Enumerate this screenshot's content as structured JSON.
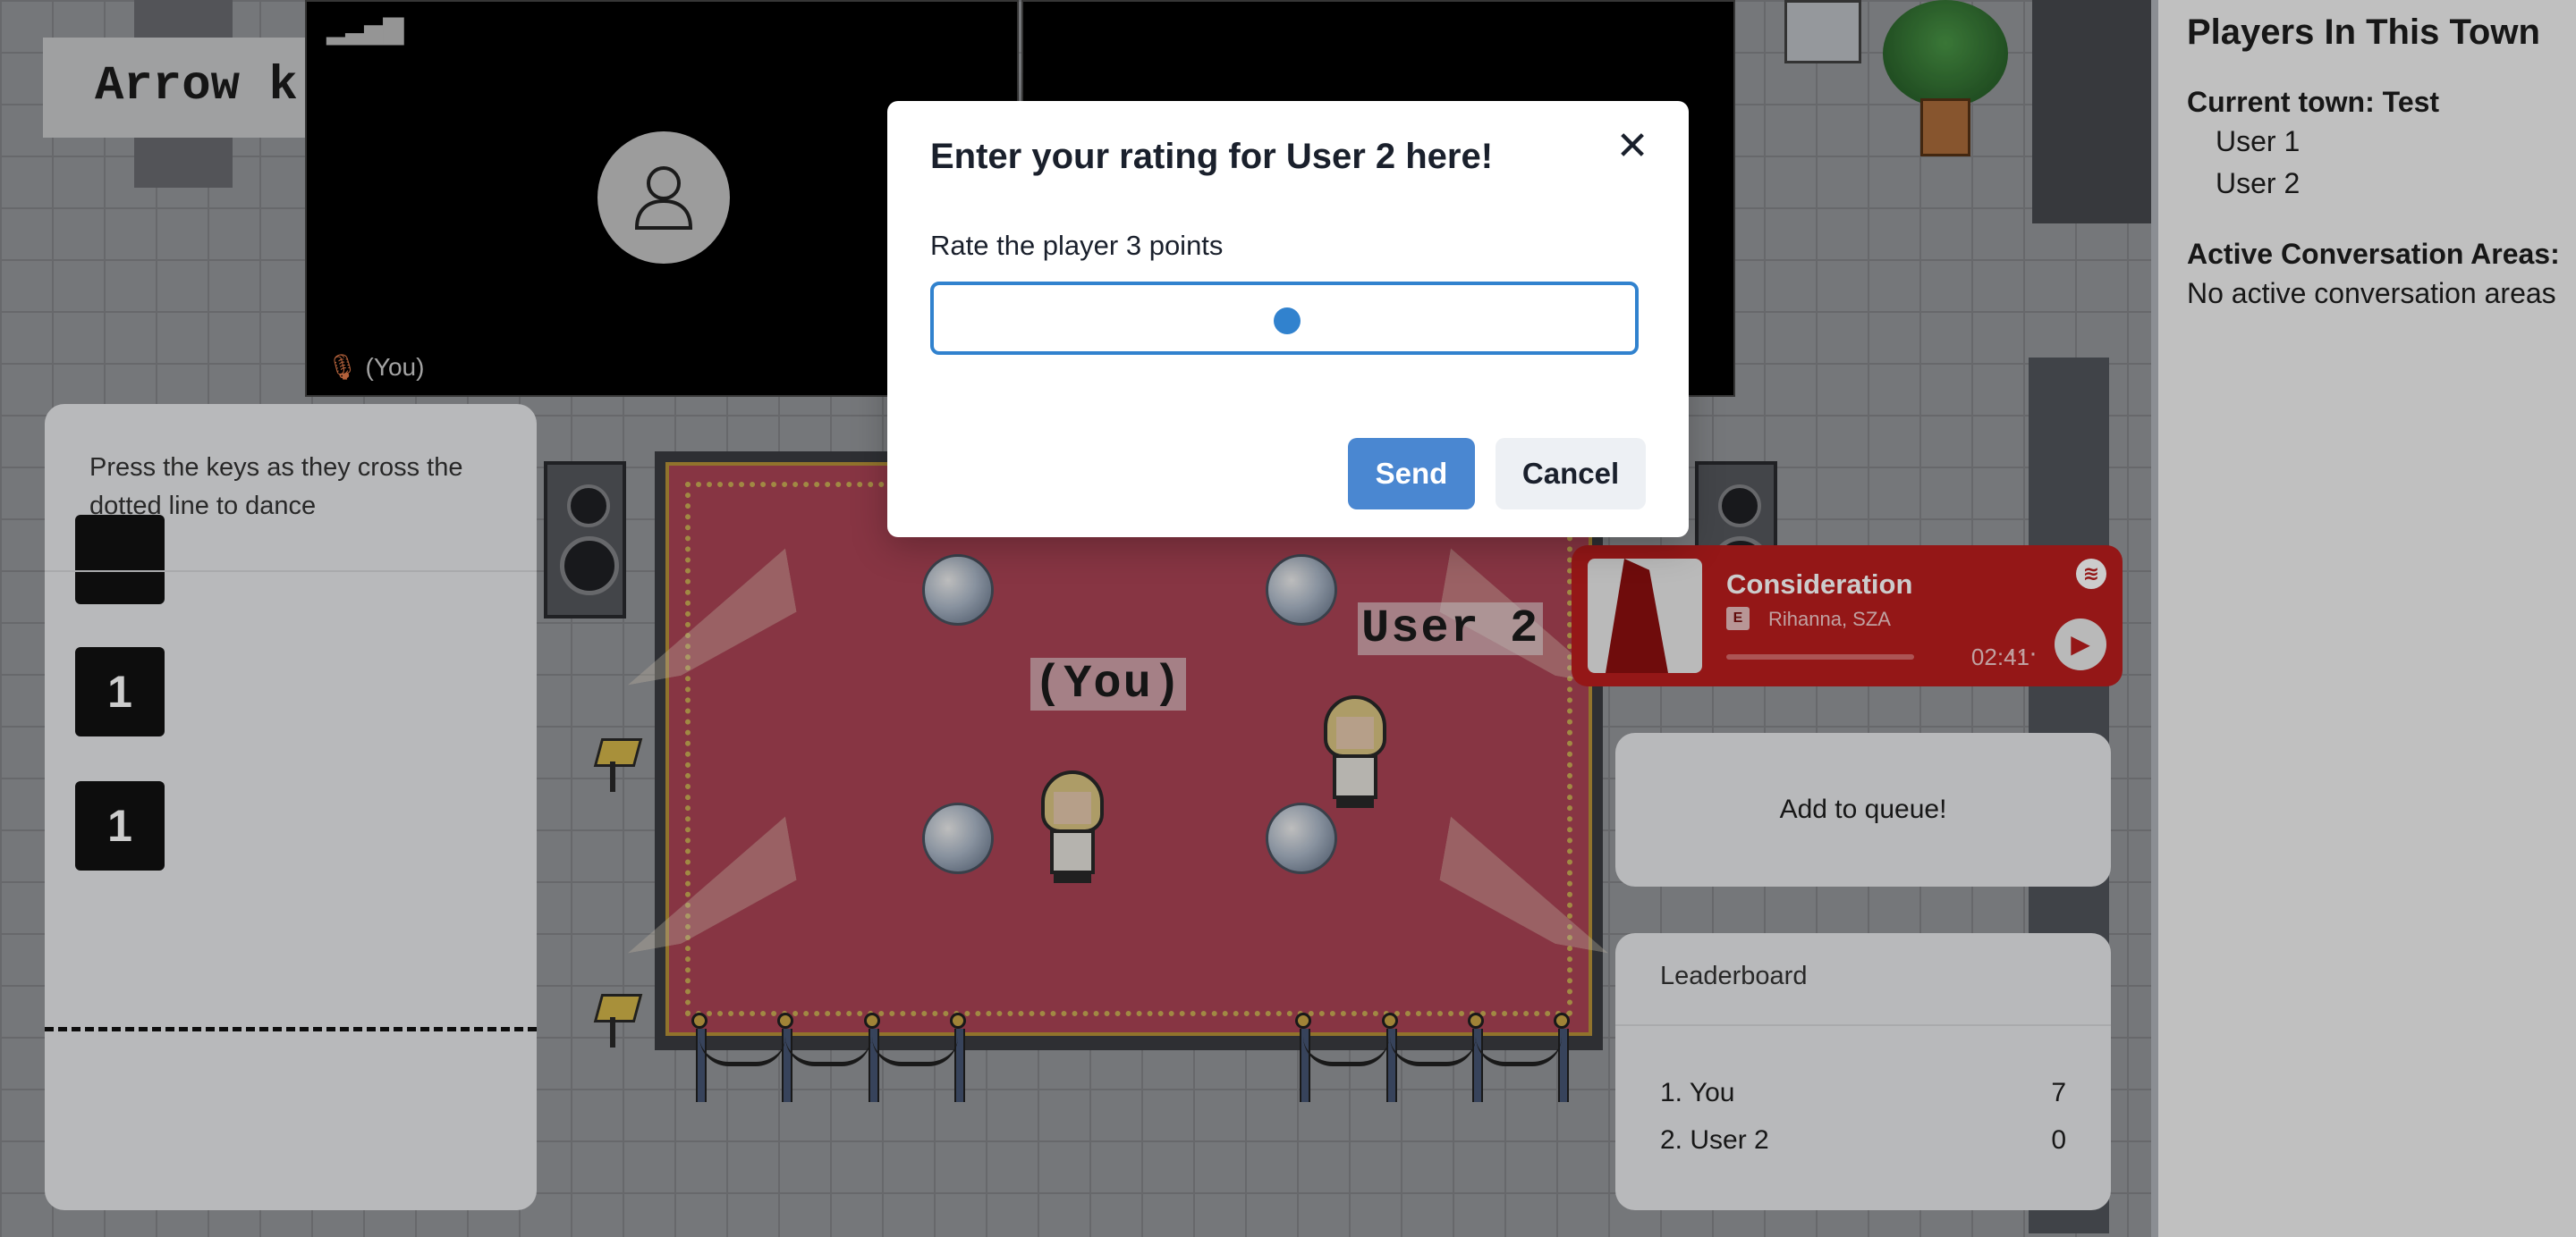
{
  "world": {
    "arrow_hint": "Arrow k",
    "you_tag": "(You)",
    "user2_tag": "User 2"
  },
  "video": {
    "signal_icon": "signal-bars-icon",
    "you_label": "(You)"
  },
  "dance": {
    "hint": "Press the keys as they cross the dotted line to dance",
    "keys": [
      "1",
      "1"
    ]
  },
  "spotify": {
    "title": "Consideration",
    "explicit_badge": "E",
    "artist": "Rihanna, SZA",
    "time": "02:41",
    "more": "···"
  },
  "queue": {
    "button_label": "Add to queue!"
  },
  "leaderboard": {
    "heading": "Leaderboard",
    "rows": [
      {
        "name": "1. You",
        "score": "7"
      },
      {
        "name": "2. User 2",
        "score": "0"
      }
    ]
  },
  "sidebar": {
    "title": "Players In This Town",
    "current_town": "Current town: Test",
    "players": [
      "User 1",
      "User 2"
    ],
    "areas_heading": "Active Conversation Areas:",
    "areas_text": "No active conversation areas"
  },
  "modal": {
    "title": "Enter your rating for User 2 here!",
    "label": "Rate the player 3 points",
    "slider_value": 3,
    "slider_max": 5,
    "send_label": "Send",
    "cancel_label": "Cancel",
    "close_glyph": "✕"
  },
  "colors": {
    "accent": "#3182ce",
    "send_button": "#4a87d1",
    "spotify_bg": "#b91d1d",
    "rug": "#b5485a"
  }
}
